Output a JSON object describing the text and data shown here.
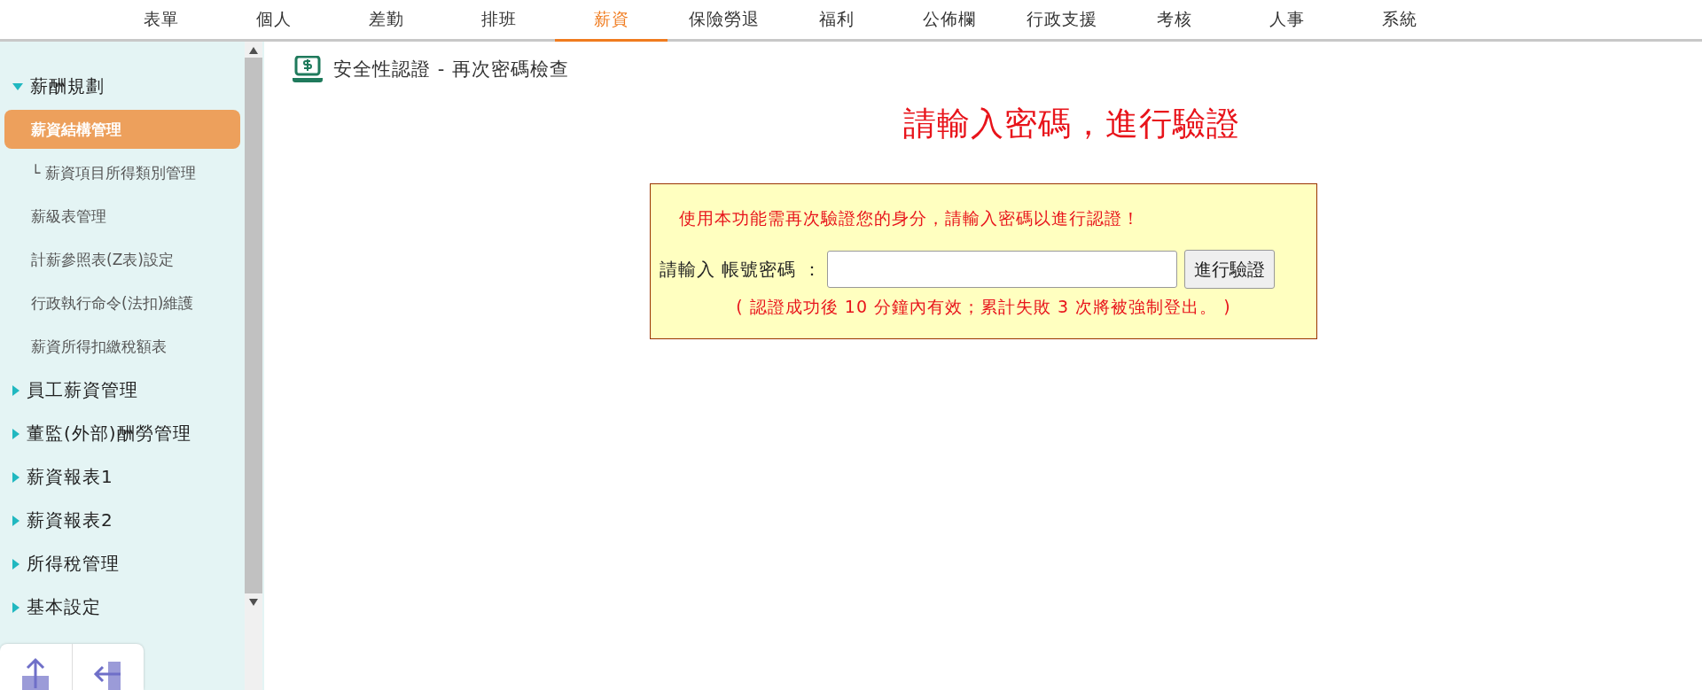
{
  "nav": [
    {
      "label": "表單",
      "selected": false
    },
    {
      "label": "個人",
      "selected": false
    },
    {
      "label": "差勤",
      "selected": false
    },
    {
      "label": "排班",
      "selected": false
    },
    {
      "label": "薪資",
      "selected": true
    },
    {
      "label": "保險勞退",
      "selected": false
    },
    {
      "label": "福利",
      "selected": false
    },
    {
      "label": "公佈欄",
      "selected": false
    },
    {
      "label": "行政支援",
      "selected": false
    },
    {
      "label": "考核",
      "selected": false
    },
    {
      "label": "人事",
      "selected": false
    },
    {
      "label": "系統",
      "selected": false
    }
  ],
  "sidebar": {
    "groups": [
      {
        "label": "薪酬規劃",
        "expanded": true,
        "items": [
          {
            "label": "薪資結構管理",
            "selected": true,
            "children": [
              {
                "label": "└ 薪資項目所得類別管理",
                "selected": false
              }
            ]
          },
          {
            "label": "薪級表管理",
            "selected": false
          },
          {
            "label": "計薪參照表(Z表)設定",
            "selected": false
          },
          {
            "label": "行政執行命令(法扣)維護",
            "selected": false
          },
          {
            "label": "薪資所得扣繳稅額表",
            "selected": false
          }
        ]
      },
      {
        "label": "員工薪資管理",
        "expanded": false
      },
      {
        "label": "董監(外部)酬勞管理",
        "expanded": false
      },
      {
        "label": "薪資報表1",
        "expanded": false
      },
      {
        "label": "薪資報表2",
        "expanded": false
      },
      {
        "label": "所得稅管理",
        "expanded": false
      },
      {
        "label": "基本設定",
        "expanded": false
      }
    ]
  },
  "page_header": {
    "title": "安全性認證 - 再次密碼檢查"
  },
  "heading": "請輸入密碼，進行驗證",
  "verify_box": {
    "message": "使用本功能需再次驗證您的身分，請輸入密碼以進行認證！",
    "field_label": "請輸入 帳號密碼 ：",
    "button": "進行驗證",
    "note": "( 認證成功後 10 分鐘內有效；累計失敗 3 次將被強制登出。 )"
  }
}
